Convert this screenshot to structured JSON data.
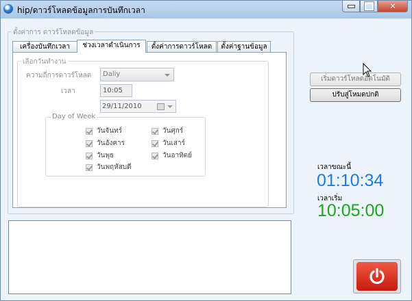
{
  "window": {
    "title": "hip/ดาวร์โหลดข้อมูลการบันทึกเวลา"
  },
  "settings_group": {
    "legend": "ตั้งค่าการ ดาวร์โหลดข้อมูล"
  },
  "tabs": [
    {
      "label": "เครื่องบันทึกเวลา",
      "active": false
    },
    {
      "label": "ช่วงเวลาดำเนินการ",
      "active": true
    },
    {
      "label": "ตั้งค่าการดาวร์โหลด",
      "active": false
    },
    {
      "label": "ตั้งค่าฐานข้อมูล",
      "active": false
    }
  ],
  "schedule": {
    "legend": "เลือกวันทำงาน",
    "frequency_label": "ความถี่การดาวร์โหลด",
    "frequency_value": "Daliy",
    "time_label": "เวลา",
    "time_value": "10:05",
    "date_value": "29/11/2010"
  },
  "day_of_week": {
    "legend": "Day of Week",
    "days": [
      {
        "label": "วันจันทร์",
        "checked": true
      },
      {
        "label": "วันอังคาร",
        "checked": true
      },
      {
        "label": "วันพุธ",
        "checked": true
      },
      {
        "label": "วันพฤหัสบดี",
        "checked": true
      },
      {
        "label": "วันศุกร์",
        "checked": true
      },
      {
        "label": "วันเสาร์",
        "checked": true
      },
      {
        "label": "วันอาทิตย์",
        "checked": true
      }
    ]
  },
  "buttons": {
    "auto_download": "เริ่มดาวร์โหลดอัตโนมัติ",
    "normal_mode": "ปรับสู่โหมดปกติ"
  },
  "clock": {
    "current_label": "เวลาขณะนี้",
    "current_time": "01:10:34",
    "current_color": "#1e7be6",
    "start_label": "เวลาเริ่ม",
    "start_time": "10:05:00",
    "start_color": "#1ca61c"
  },
  "power": {
    "icon": "power-icon",
    "color": "#d9251a"
  }
}
